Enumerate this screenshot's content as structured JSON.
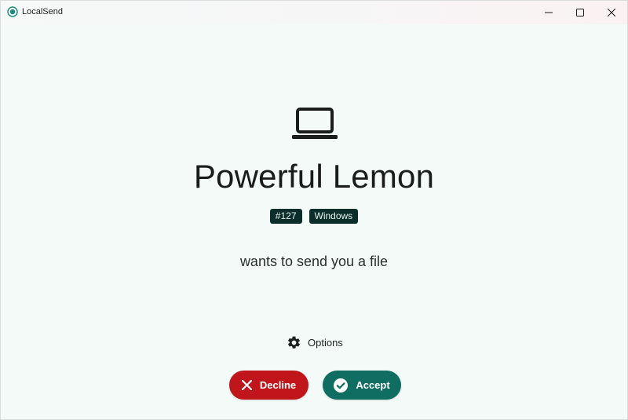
{
  "window": {
    "title": "LocalSend",
    "accent_color": "#0f6d61"
  },
  "device": {
    "icon": "laptop-icon",
    "name": "Powerful Lemon",
    "badges": [
      "#127",
      "Windows"
    ]
  },
  "message": "wants to send you a file",
  "options": {
    "icon": "gear-icon",
    "label": "Options"
  },
  "actions": {
    "decline": {
      "label": "Decline",
      "icon": "close-icon",
      "color": "#c0161b"
    },
    "accept": {
      "label": "Accept",
      "icon": "check-circle-icon",
      "color": "#0f6d61"
    }
  }
}
